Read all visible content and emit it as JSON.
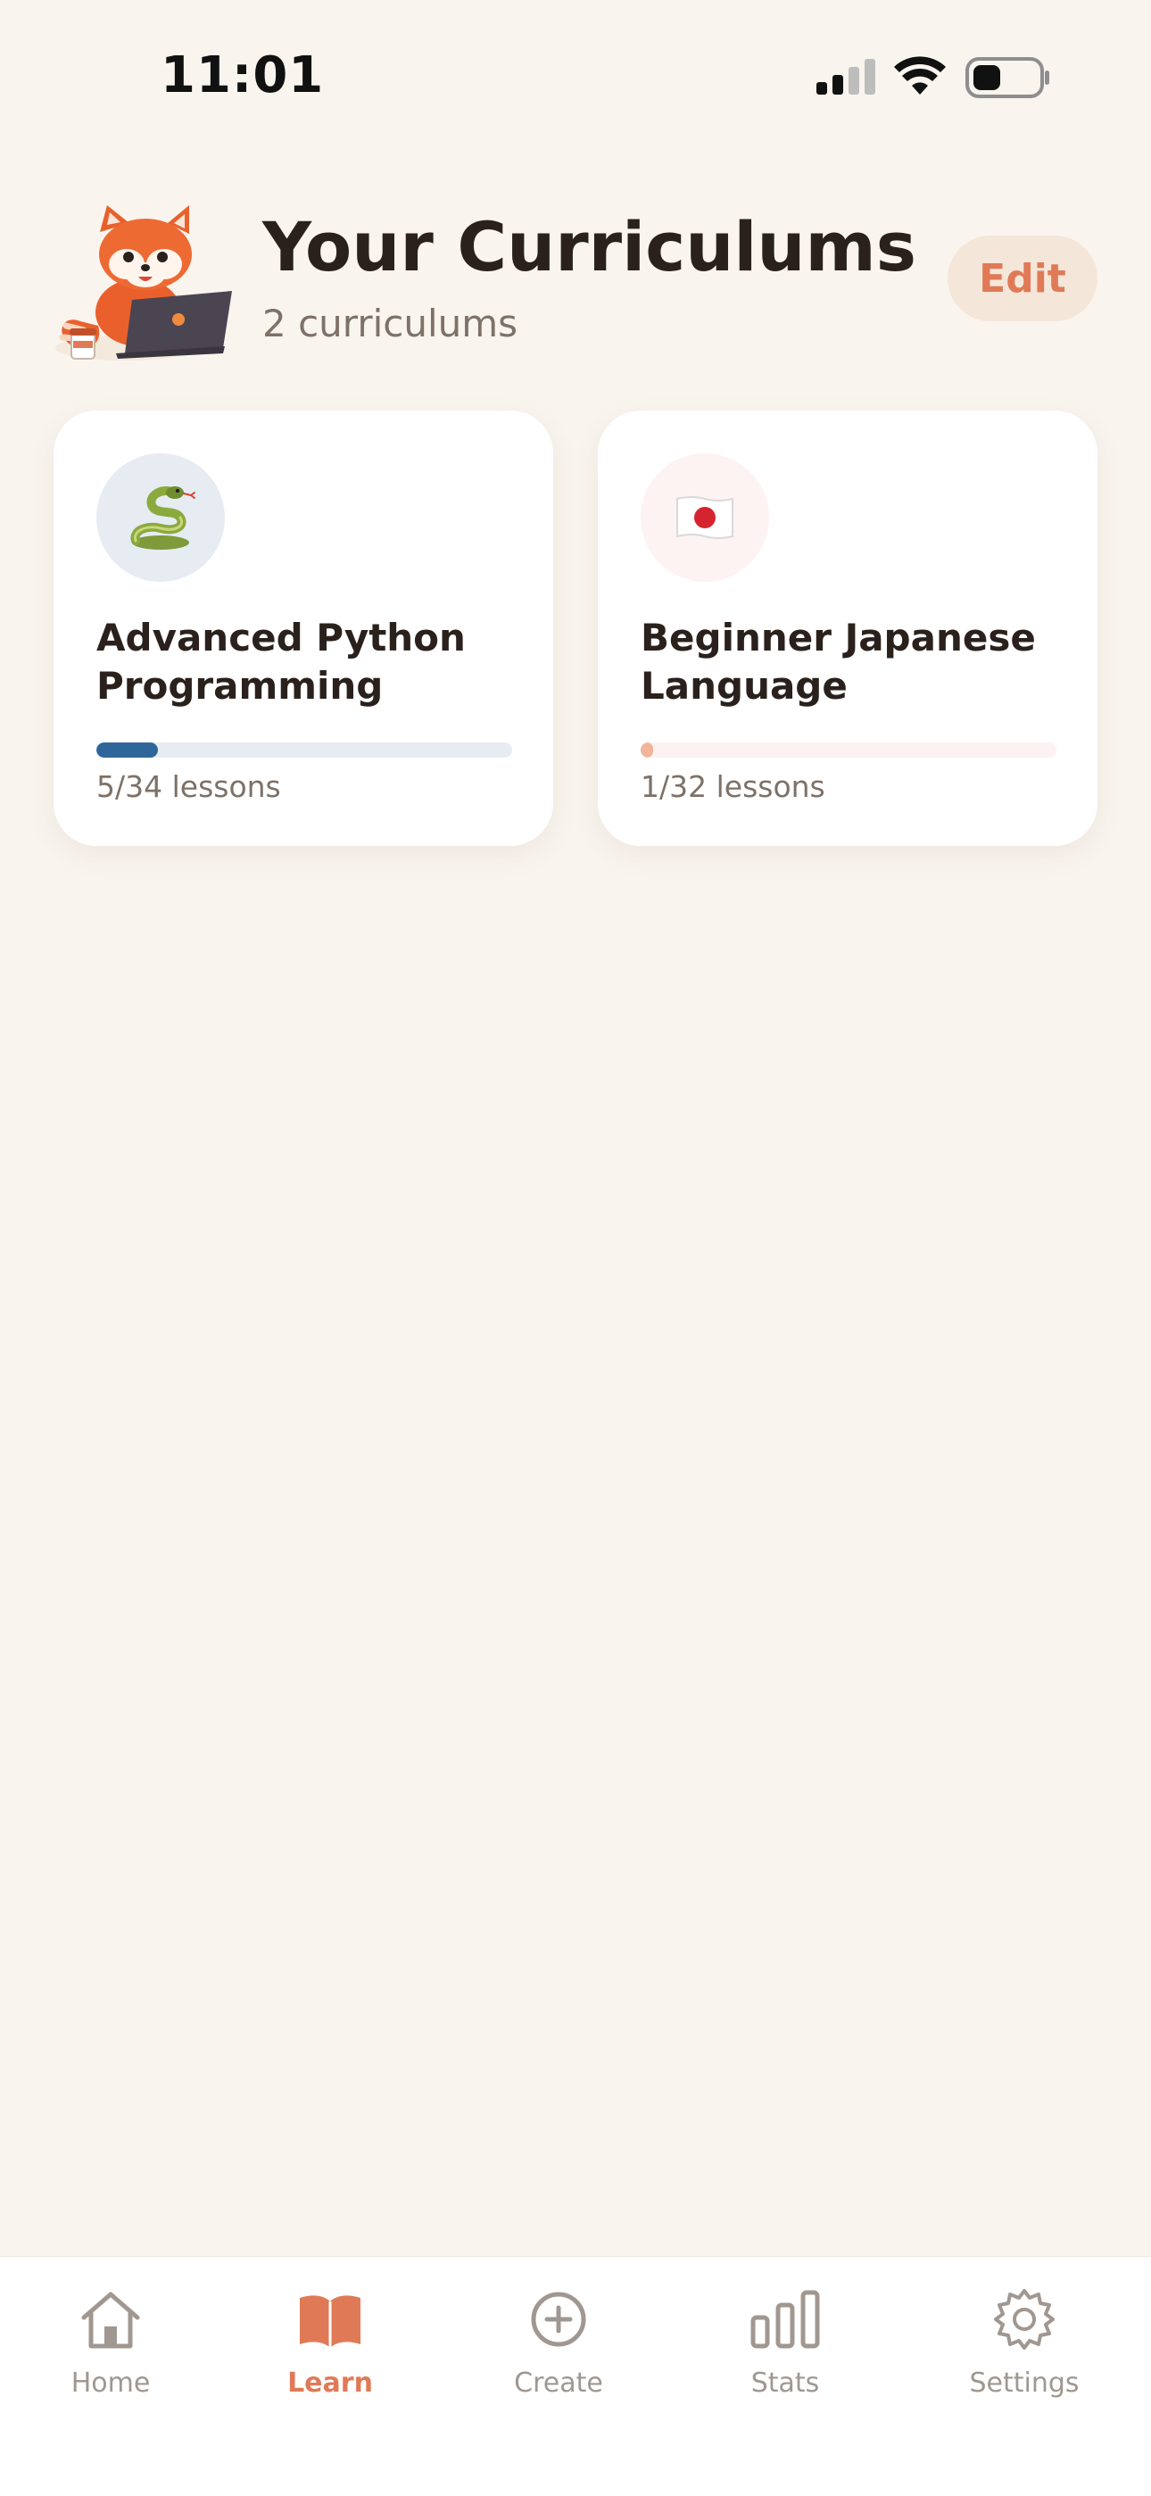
{
  "status_bar": {
    "time": "11:01"
  },
  "header": {
    "title": "Your Curriculums",
    "subtitle": "2 curriculums",
    "edit_label": "Edit"
  },
  "curriculums": [
    {
      "title": "Advanced Python Programming",
      "icon": "snake-emoji",
      "lessons": "5/34 lessons",
      "progress": 0.147,
      "accent": "#2E6699"
    },
    {
      "title": "Beginner Japanese Language",
      "icon": "japan-flag-emoji",
      "lessons": "1/32 lessons",
      "progress": 0.031,
      "accent": "#F2B49A"
    }
  ],
  "tab_bar": {
    "active": "Learn",
    "items": [
      {
        "label": "Home",
        "icon": "house-icon"
      },
      {
        "label": "Learn",
        "icon": "open-book-icon"
      },
      {
        "label": "Create",
        "icon": "plus-circle-icon"
      },
      {
        "label": "Stats",
        "icon": "bar-chart-icon"
      },
      {
        "label": "Settings",
        "icon": "gear-icon"
      }
    ]
  },
  "colors": {
    "background": "#F9F4EE",
    "accent": "#E07A56",
    "text_primary": "#2A211D",
    "text_secondary": "#7D7168"
  }
}
